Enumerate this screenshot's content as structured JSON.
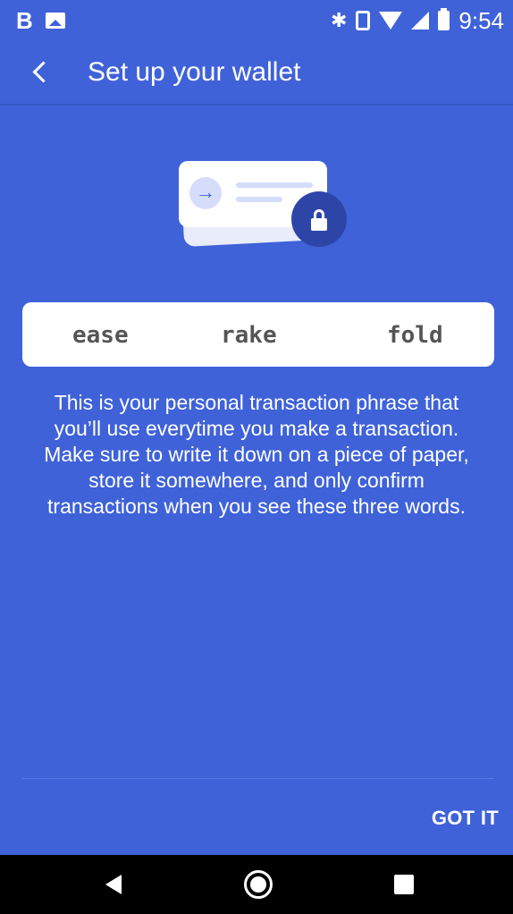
{
  "status_bar": {
    "left_letter": "B",
    "time": "9:54",
    "bluetooth_glyph": "✱",
    "icons": [
      "b-notification-icon",
      "image-notification-icon",
      "bluetooth-icon",
      "vibrate-icon",
      "wifi-icon",
      "cell-signal-icon",
      "battery-icon"
    ]
  },
  "app_bar": {
    "title": "Set up your wallet",
    "back_icon": "back-arrow-icon"
  },
  "illustration": {
    "icons": [
      "arrow-right-icon",
      "lock-icon"
    ],
    "accent_color": "#3f62d9",
    "lock_circle_color": "#2e45a8"
  },
  "phrase": {
    "words": [
      "ease",
      "rake",
      "fold"
    ]
  },
  "description": "This is your personal transaction phrase that you’ll use everytime you make a transaction. Make sure to write it down on a piece of paper, store it somewhere, and only confirm transactions when you see these three words.",
  "actions": {
    "got_it_label": "GOT IT"
  },
  "nav_bar": {
    "icons": [
      "nav-back-icon",
      "nav-home-icon",
      "nav-recents-icon"
    ]
  },
  "colors": {
    "background": "#3f62d9",
    "card": "#ffffff",
    "text": "#ffffff"
  }
}
